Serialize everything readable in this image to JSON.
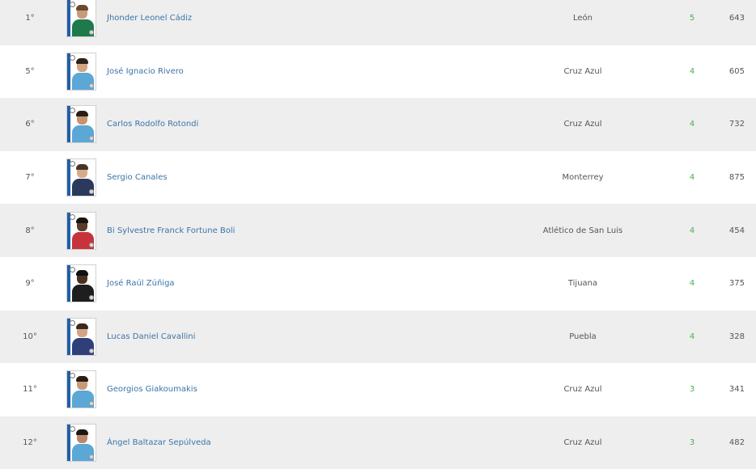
{
  "rows": [
    {
      "rank": "1°",
      "name": "Jhonder Leonel Cádiz",
      "team": "León",
      "goals": "5",
      "minutes": "643",
      "shirt_color": "#1e7a4a",
      "skin": "#c99a7a",
      "hair": "#6b4a2a"
    },
    {
      "rank": "5°",
      "name": "José Ignacio Rivero",
      "team": "Cruz Azul",
      "goals": "4",
      "minutes": "605",
      "shirt_color": "#5ba7d6",
      "skin": "#d2a483",
      "hair": "#2e2218"
    },
    {
      "rank": "6°",
      "name": "Carlos Rodolfo Rotondi",
      "team": "Cruz Azul",
      "goals": "4",
      "minutes": "732",
      "shirt_color": "#5ba7d6",
      "skin": "#c4956f",
      "hair": "#2a1e16"
    },
    {
      "rank": "7°",
      "name": "Sergio Canales",
      "team": "Monterrey",
      "goals": "4",
      "minutes": "875",
      "shirt_color": "#2b3a5c",
      "skin": "#d6ab8a",
      "hair": "#4a3424"
    },
    {
      "rank": "8°",
      "name": "Bi Sylvestre Franck Fortune Boli",
      "team": "Atlético de San Luis",
      "goals": "4",
      "minutes": "454",
      "shirt_color": "#c8323a",
      "skin": "#5a3a28",
      "hair": "#1a1410"
    },
    {
      "rank": "9°",
      "name": "José Raúl Zúñiga",
      "team": "Tijuana",
      "goals": "4",
      "minutes": "375",
      "shirt_color": "#1e1e1e",
      "skin": "#4a3020",
      "hair": "#121010"
    },
    {
      "rank": "10°",
      "name": "Lucas Daniel Cavallini",
      "team": "Puebla",
      "goals": "4",
      "minutes": "328",
      "shirt_color": "#2f3f7a",
      "skin": "#d4a585",
      "hair": "#3a2a1c"
    },
    {
      "rank": "11°",
      "name": "Georgios Giakoumakis",
      "team": "Cruz Azul",
      "goals": "3",
      "minutes": "341",
      "shirt_color": "#5ba7d6",
      "skin": "#c99a7a",
      "hair": "#2a1e16"
    },
    {
      "rank": "12°",
      "name": "Ángel Baltazar Sepúlveda",
      "team": "Cruz Azul",
      "goals": "3",
      "minutes": "482",
      "shirt_color": "#5ba7d6",
      "skin": "#b9876a",
      "hair": "#1e1612"
    }
  ],
  "colors": {
    "link": "#3a75a8",
    "goals": "#4caf50",
    "row_alt": "#eeeeee",
    "sticker_band": "#1f5fa8"
  },
  "icons": {
    "player_photo": "player-sticker-icon",
    "team_badge": "club-crest-icon"
  }
}
